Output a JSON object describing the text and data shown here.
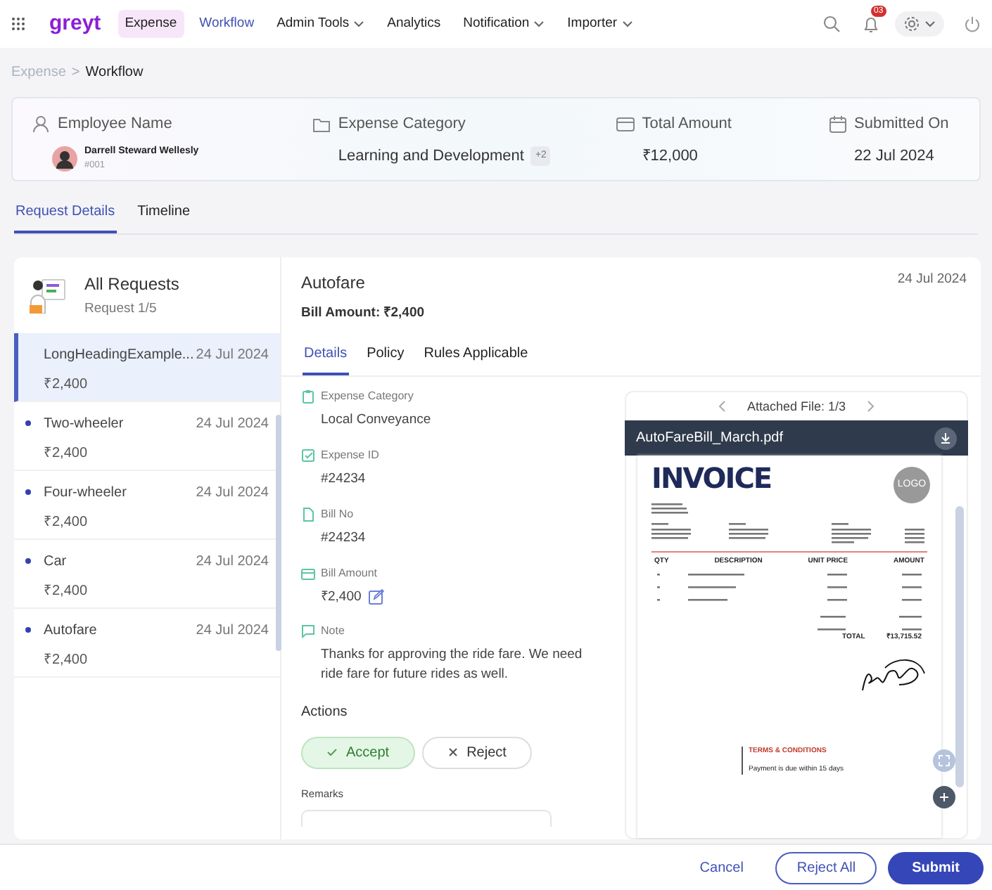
{
  "nav": {
    "brand": "greyt",
    "items": [
      {
        "label": "Expense",
        "selected": true,
        "highlighted": false,
        "dropdown": false
      },
      {
        "label": "Workflow",
        "selected": false,
        "highlighted": true,
        "dropdown": false
      },
      {
        "label": "Admin Tools",
        "selected": false,
        "highlighted": false,
        "dropdown": true
      },
      {
        "label": "Analytics",
        "selected": false,
        "highlighted": false,
        "dropdown": false
      },
      {
        "label": "Notification",
        "selected": false,
        "highlighted": false,
        "dropdown": true
      },
      {
        "label": "Importer",
        "selected": false,
        "highlighted": false,
        "dropdown": true
      }
    ],
    "notification_count": "03"
  },
  "breadcrumb": {
    "items": [
      "Expense",
      "Workflow"
    ],
    "separator": ">"
  },
  "summary": [
    {
      "kind": "employee",
      "label": "Employee Name",
      "value": "Darrell Steward Wellesly",
      "sub": "#001"
    },
    {
      "kind": "category",
      "label": "Expense Category",
      "value": "Learning and Development",
      "badge": "+2"
    },
    {
      "kind": "amount",
      "label": "Total Amount",
      "value": "₹12,000"
    },
    {
      "kind": "date",
      "label": "Submitted On",
      "value": "22 Jul 2024"
    }
  ],
  "tabs": [
    {
      "label": "Request Details",
      "selected": true
    },
    {
      "label": "Timeline",
      "selected": false
    }
  ],
  "requests": {
    "title": "All Requests",
    "subtitle": "Request 1/5",
    "items": [
      {
        "title": "LongHeadingExample...",
        "date": "24 Jul 2024",
        "amount": "₹2,400",
        "selected": true,
        "unread": false
      },
      {
        "title": "Two-wheeler",
        "date": "24 Jul 2024",
        "amount": "₹2,400",
        "selected": false,
        "unread": true
      },
      {
        "title": "Four-wheeler",
        "date": "24 Jul 2024",
        "amount": "₹2,400",
        "selected": false,
        "unread": true
      },
      {
        "title": "Car",
        "date": "24 Jul 2024",
        "amount": "₹2,400",
        "selected": false,
        "unread": true
      },
      {
        "title": "Autofare",
        "date": "24 Jul 2024",
        "amount": "₹2,400",
        "selected": false,
        "unread": true
      }
    ]
  },
  "detail": {
    "title": "Autofare",
    "date": "24 Jul 2024",
    "bill_label": "Bill Amount:",
    "bill_value": "₹2,400",
    "tabs": [
      {
        "label": "Details",
        "selected": true
      },
      {
        "label": "Policy",
        "selected": false
      },
      {
        "label": "Rules Applicable",
        "selected": false
      }
    ],
    "fields": [
      {
        "kind": "category",
        "label": "Expense Category",
        "value": "Local Conveyance",
        "editable": false
      },
      {
        "kind": "id",
        "label": "Expense ID",
        "value": "#24234",
        "editable": false
      },
      {
        "kind": "bill",
        "label": "Bill No",
        "value": "#24234",
        "editable": false
      },
      {
        "kind": "amount",
        "label": "Bill Amount",
        "value": "₹2,400",
        "editable": true
      },
      {
        "kind": "note",
        "label": "Note",
        "value": "Thanks for approving the ride fare. We need ride fare for future rides as well.",
        "editable": false
      }
    ],
    "actions_title": "Actions",
    "actions": [
      {
        "kind": "accept",
        "label": "Accept",
        "selected": true
      },
      {
        "kind": "reject",
        "label": "Reject",
        "selected": false
      }
    ],
    "remarks_label": "Remarks"
  },
  "viewer": {
    "caption": "Attached File: 1/3",
    "filename": "AutoFareBill_March.pdf",
    "document": {
      "title": "INVOICE",
      "logo": "LOGO",
      "columns": [
        "QTY",
        "DESCRIPTION",
        "UNIT PRICE",
        "AMOUNT"
      ],
      "total_label": "TOTAL",
      "total_value": "₹13,715.52",
      "terms_title": "TERMS & CONDITIONS",
      "terms_text": "Payment is due within 15 days"
    }
  },
  "footer": [
    {
      "kind": "link",
      "label": "Cancel"
    },
    {
      "kind": "outline",
      "label": "Reject All"
    },
    {
      "kind": "primary",
      "label": "Submit"
    }
  ]
}
